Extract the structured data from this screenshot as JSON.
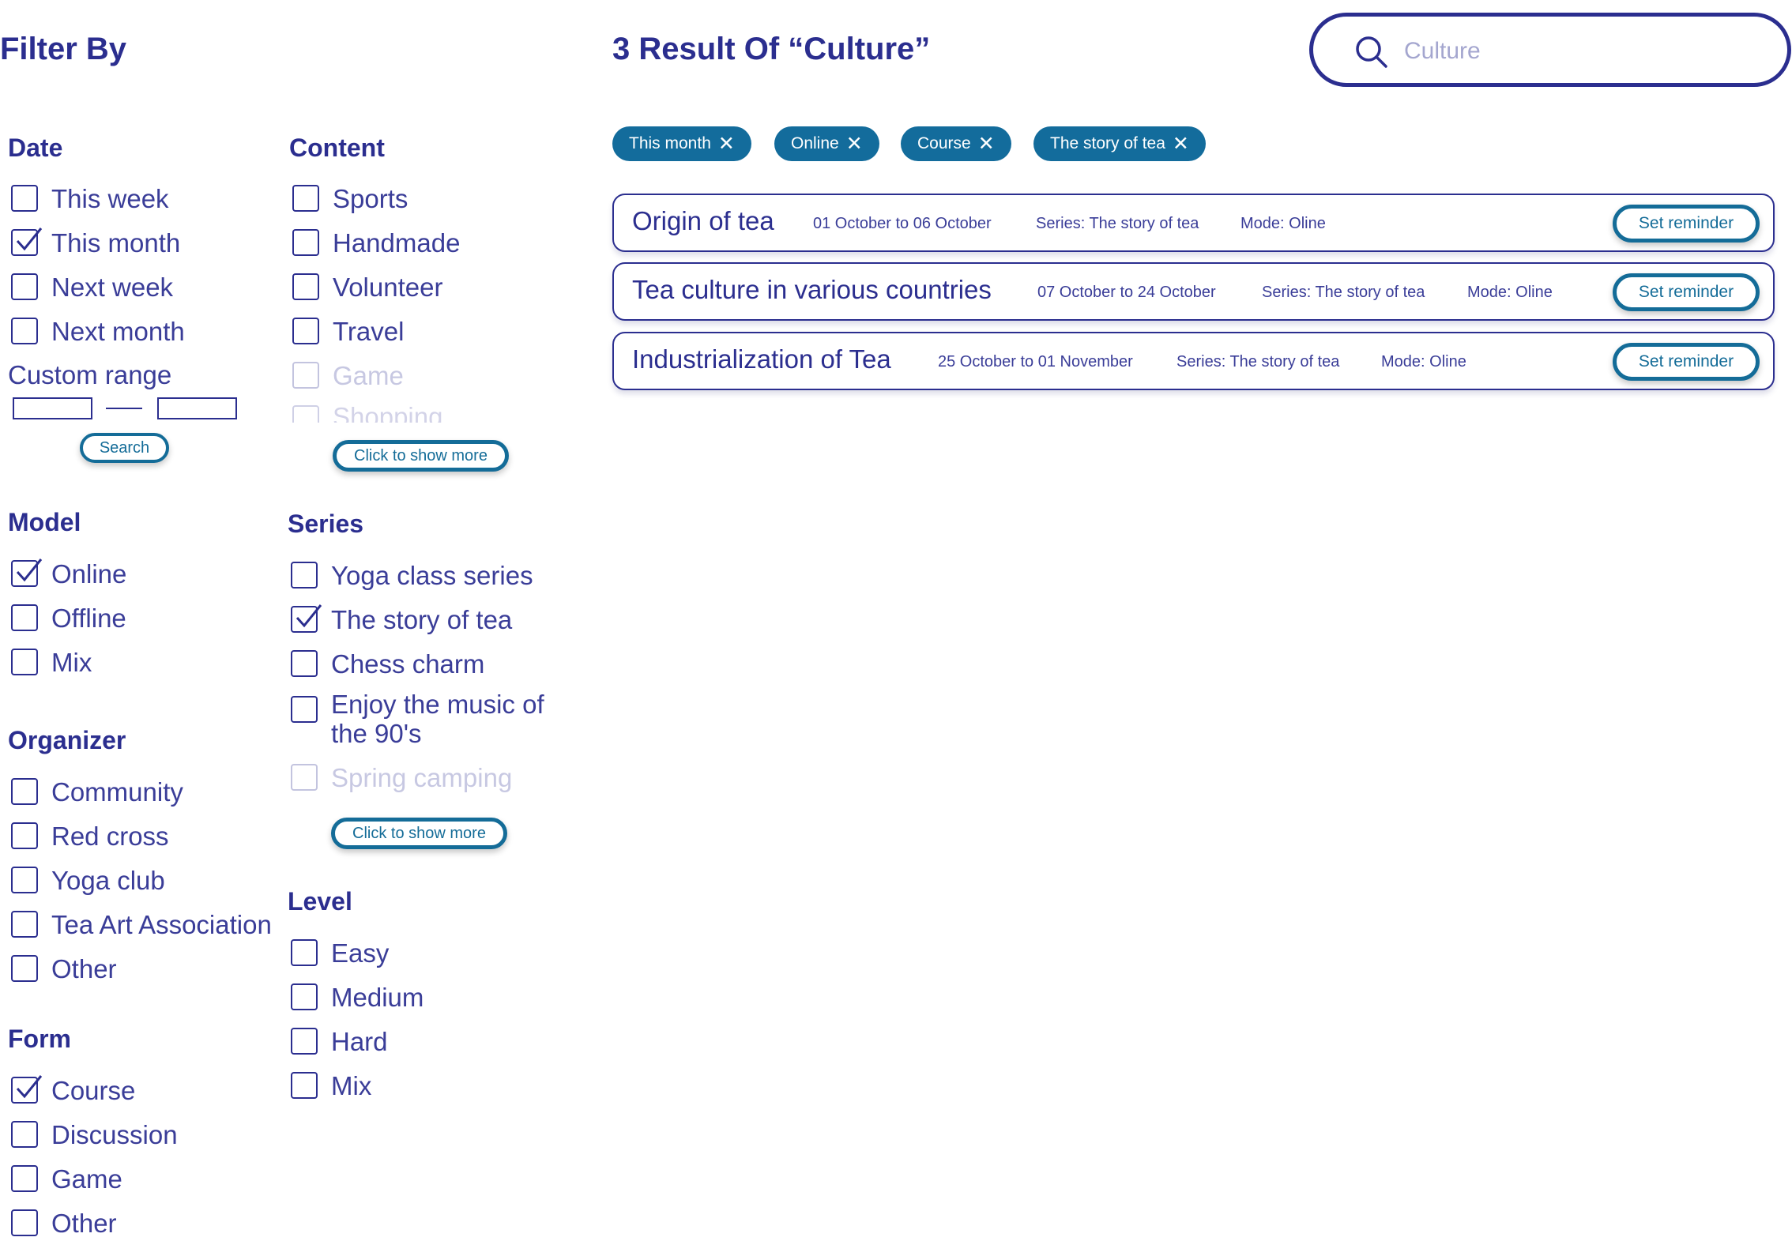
{
  "filter": {
    "title": "Filter By",
    "search_label": "Search",
    "show_more_label": "Click to show more",
    "date": {
      "heading": "Date",
      "options": [
        {
          "label": "This week",
          "checked": false
        },
        {
          "label": "This month",
          "checked": true
        },
        {
          "label": "Next week",
          "checked": false
        },
        {
          "label": "Next month",
          "checked": false
        }
      ],
      "custom_range_label": "Custom range"
    },
    "content": {
      "heading": "Content",
      "options": [
        {
          "label": "Sports",
          "checked": false
        },
        {
          "label": "Handmade",
          "checked": false
        },
        {
          "label": "Volunteer",
          "checked": false
        },
        {
          "label": "Travel",
          "checked": false
        },
        {
          "label": "Game",
          "checked": false
        },
        {
          "label": "Shopping",
          "checked": false
        }
      ]
    },
    "model": {
      "heading": "Model",
      "options": [
        {
          "label": "Online",
          "checked": true
        },
        {
          "label": "Offline",
          "checked": false
        },
        {
          "label": "Mix",
          "checked": false
        }
      ]
    },
    "series": {
      "heading": "Series",
      "options": [
        {
          "label": "Yoga class series",
          "checked": false
        },
        {
          "label": "The story of tea",
          "checked": true
        },
        {
          "label": "Chess charm",
          "checked": false
        },
        {
          "label": "Enjoy the music of the 90's",
          "checked": false
        },
        {
          "label": "Spring camping",
          "checked": false
        }
      ]
    },
    "organizer": {
      "heading": "Organizer",
      "options": [
        {
          "label": "Community",
          "checked": false
        },
        {
          "label": "Red cross",
          "checked": false
        },
        {
          "label": "Yoga club",
          "checked": false
        },
        {
          "label": "Tea Art Association",
          "checked": false
        },
        {
          "label": "Other",
          "checked": false
        }
      ]
    },
    "level": {
      "heading": "Level",
      "options": [
        {
          "label": "Easy",
          "checked": false
        },
        {
          "label": "Medium",
          "checked": false
        },
        {
          "label": "Hard",
          "checked": false
        },
        {
          "label": "Mix",
          "checked": false
        }
      ]
    },
    "form": {
      "heading": "Form",
      "options": [
        {
          "label": "Course",
          "checked": true
        },
        {
          "label": "Discussion",
          "checked": false
        },
        {
          "label": "Game",
          "checked": false
        },
        {
          "label": "Other",
          "checked": false
        }
      ]
    }
  },
  "results": {
    "title": "3 Result Of “Culture”",
    "search": {
      "placeholder": "Culture",
      "icon": "search-icon"
    },
    "chips": [
      "This month",
      "Online",
      "Course",
      "The story of tea"
    ],
    "chip_close_glyph": "✕",
    "reminder_label": "Set reminder",
    "items": [
      {
        "title": "Origin of tea",
        "dates": "01 October to 06 October",
        "series": "Series: The story of tea",
        "mode": "Mode: Oline"
      },
      {
        "title": "Tea culture in various countries",
        "dates": "07 October to 24 October",
        "series": "Series: The story of tea",
        "mode": "Mode: Oline"
      },
      {
        "title": "Industrialization of Tea",
        "dates": "25 October to 01 November",
        "series": "Series: The story of tea",
        "mode": "Mode: Oline"
      }
    ]
  },
  "colors": {
    "text": "#2b2e8f",
    "chip": "#136c9c",
    "button_border": "#146c98",
    "placeholder": "#a4a6cf"
  }
}
